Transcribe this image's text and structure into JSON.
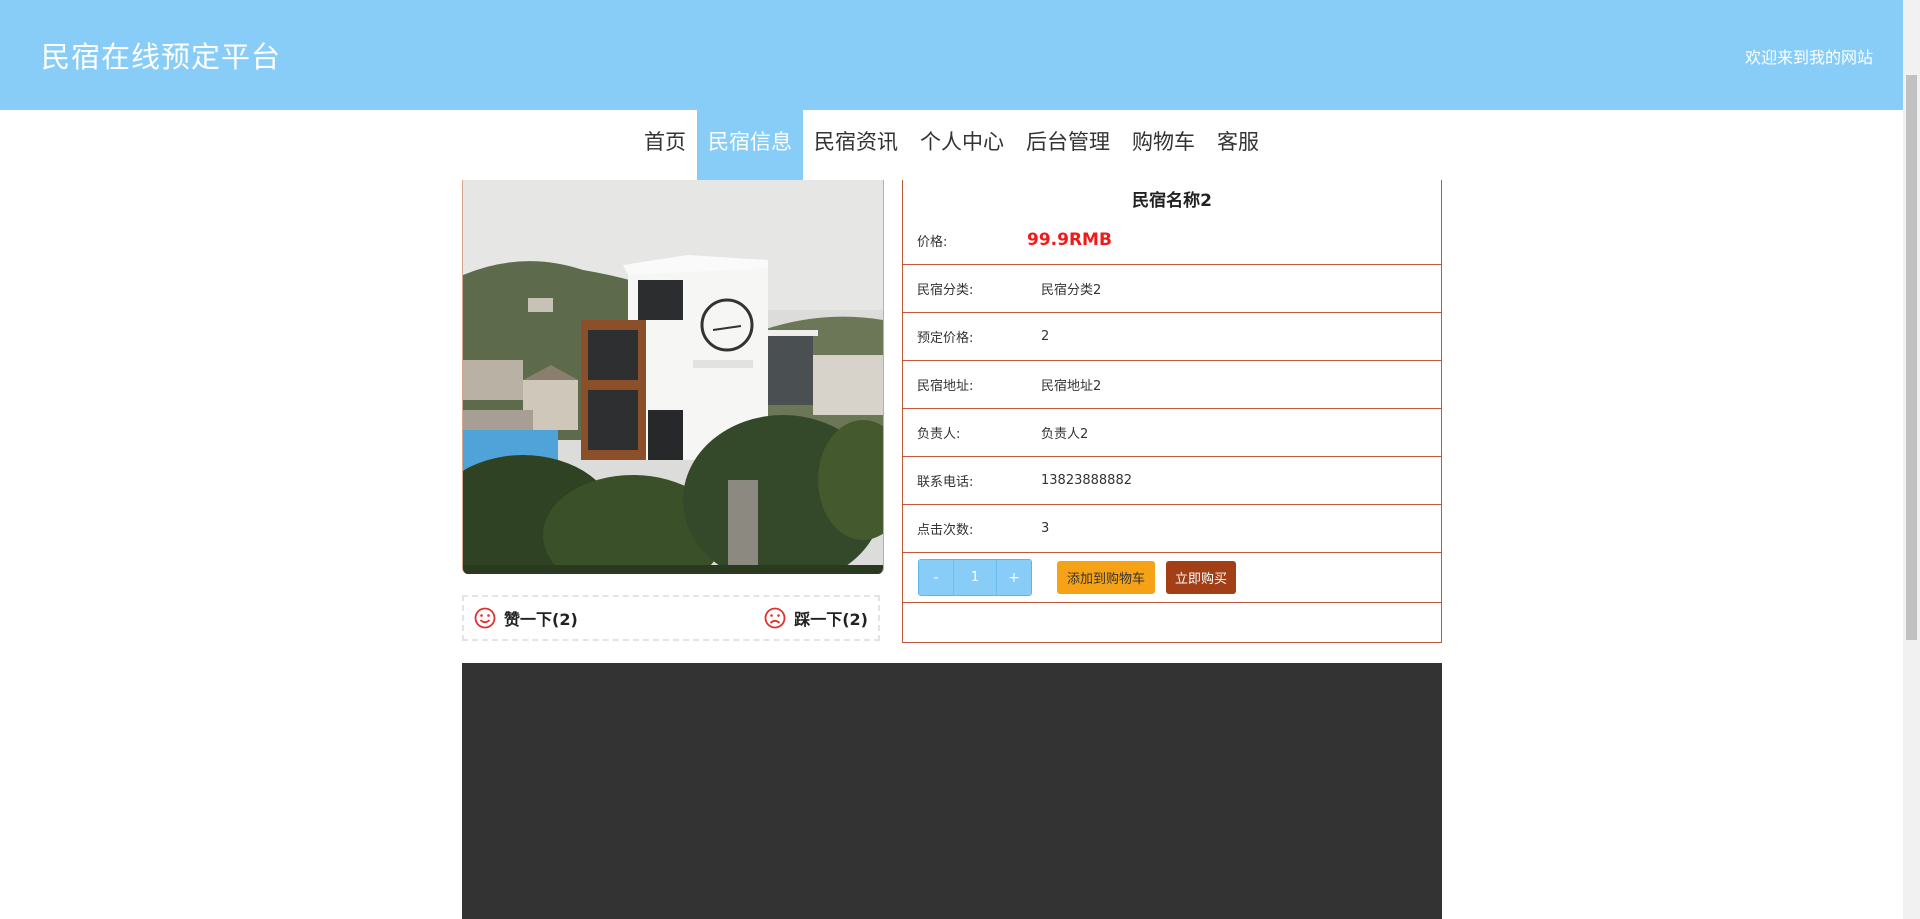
{
  "header": {
    "site_title": "民宿在线预定平台",
    "welcome": "欢迎来到我的网站"
  },
  "nav": {
    "items": [
      "首页",
      "民宿信息",
      "民宿资讯",
      "个人中心",
      "后台管理",
      "购物车",
      "客服"
    ],
    "active_index": 1
  },
  "votes": {
    "like": "赞一下(2)",
    "dislike": "踩一下(2)"
  },
  "detail": {
    "title": "民宿名称2",
    "price_label": "价格:",
    "price_value": "99.9RMB",
    "rows": [
      {
        "label": "民宿分类:",
        "value": "民宿分类2"
      },
      {
        "label": "预定价格:",
        "value": "2"
      },
      {
        "label": "民宿地址:",
        "value": "民宿地址2"
      },
      {
        "label": "负责人:",
        "value": "负责人2"
      },
      {
        "label": "联系电话:",
        "value": "13823888882"
      },
      {
        "label": "点击次数:",
        "value": "3"
      }
    ],
    "stepper": {
      "minus": "-",
      "quantity": "1",
      "plus": "+"
    },
    "add_to_cart": "添加到购物车",
    "buy_now": "立即购买"
  },
  "colors": {
    "header_bg": "#87cdf8",
    "border": "#c0583a",
    "price": "#ef1a1a",
    "cart_button": "#f5a216",
    "buy_button": "#a23f17"
  },
  "icons": {
    "like": "smile-icon",
    "dislike": "frown-icon"
  }
}
